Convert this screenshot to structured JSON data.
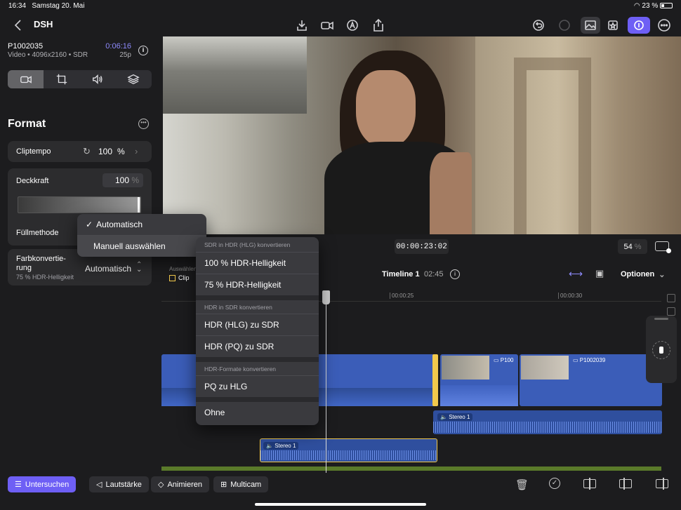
{
  "status": {
    "time": "16:34",
    "date": "Samstag 20. Mai",
    "battery": "23 %"
  },
  "header": {
    "title": "DSH"
  },
  "clip": {
    "name": "P1002035",
    "timecode": "0:06:16",
    "meta": "Video • 4096x2160 • SDR",
    "fps": "25p"
  },
  "inspector": {
    "section_title": "Format",
    "cliptempo_label": "Cliptempo",
    "cliptempo_value": "100",
    "cliptempo_unit": "%",
    "opacity_label": "Deckkraft",
    "opacity_value": "100",
    "opacity_unit": "%",
    "blend_label": "Füllmethode",
    "farb_label": "Farbkonvertie-rung",
    "farb_sub": "75 % HDR-Helligkeit",
    "farb_value": "Automatisch"
  },
  "blend_menu": {
    "item1": "Automatisch",
    "item2": "Manuell auswählen"
  },
  "hdr_menu": {
    "hdr1": "SDR in HDR (HLG) konvertieren",
    "o1": "100 % HDR-Helligkeit",
    "o2": "75 % HDR-Helligkeit",
    "hdr2": "HDR in SDR konvertieren",
    "o3": "HDR (HLG) zu SDR",
    "o4": "HDR (PQ) zu SDR",
    "hdr3": "HDR-Formate konvertieren",
    "o5": "PQ zu HLG",
    "o6": "Ohne"
  },
  "viewer": {
    "timecode": "00:00:23:02",
    "zoom": "54",
    "zoom_unit": "%"
  },
  "timeline": {
    "select_label": "Auswählen",
    "clip_label": "Clip",
    "name": "Timeline 1",
    "duration": "02:45",
    "options": "Optionen",
    "ruler1": "00:00:25",
    "ruler2": "00:00:30",
    "clip_p100": "P100",
    "clip_p1002039": "P1002039",
    "audio1": "Stereo 1",
    "audio2": "Stereo 1"
  },
  "bottom": {
    "inspect": "Untersuchen",
    "volume": "Lautstärke",
    "animate": "Animieren",
    "multicam": "Multicam"
  },
  "colors": {
    "accent": "#6e5ff5",
    "clip_blue": "#3b5db8",
    "selection_yellow": "#f2c94c"
  }
}
